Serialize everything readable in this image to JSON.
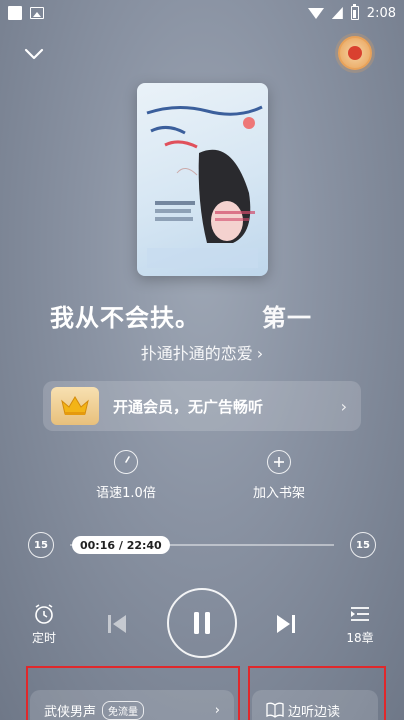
{
  "status_bar": {
    "time": "2:08"
  },
  "track": {
    "title": "我从不会扶。",
    "title_next": "第一"
  },
  "album": {
    "name": "扑通扑通的恋爱",
    "arrow": "›"
  },
  "vip": {
    "text": "开通会员，无广告畅听",
    "arrow": "›"
  },
  "actions": {
    "speed_label": "语速1.0倍",
    "bookshelf_label": "加入书架"
  },
  "progress": {
    "time_text": "00:16 / 22:40",
    "fraction": 0.012,
    "rewind_label": "15",
    "forward_label": "15"
  },
  "controls": {
    "timer_label": "定时",
    "chapters_label": "18章"
  },
  "bottom": {
    "left_title": "武侠男声",
    "left_badge": "免流量",
    "left_arrow": "›",
    "right_title": "边听边读"
  },
  "colors": {
    "accent_red": "#e0282b",
    "vip_gold": "#e8c07c"
  }
}
